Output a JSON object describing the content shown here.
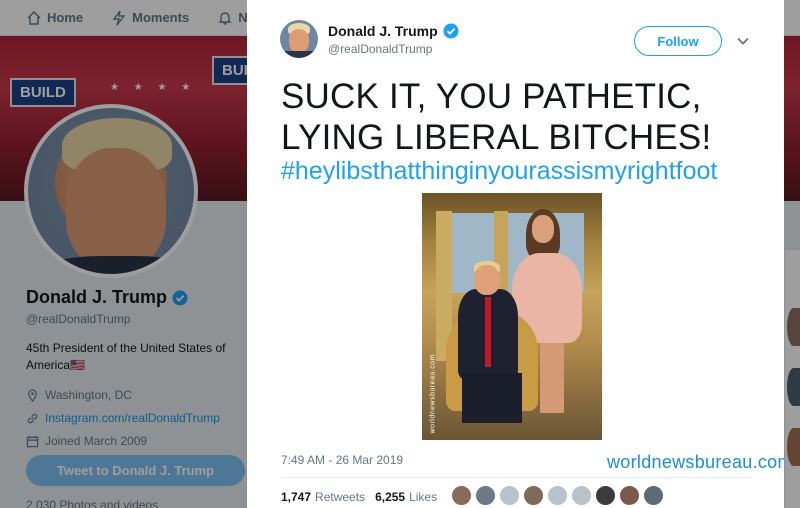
{
  "nav": {
    "home": "Home",
    "moments": "Moments",
    "notifications": "Notif"
  },
  "banner": {
    "sign_text": "BUILD"
  },
  "profile": {
    "name": "Donald J. Trump",
    "handle": "@realDonaldTrump",
    "bio": "45th President of the United States of America",
    "flag": "🇺🇸",
    "location": "Washington, DC",
    "website": "Instagram.com/realDonaldTrump",
    "joined": "Joined March 2009",
    "tweet_to_button": "Tweet to Donald J. Trump",
    "photos_label": "2,030 Photos and videos"
  },
  "tweet": {
    "author_name": "Donald J. Trump",
    "author_handle": "@realDonaldTrump",
    "follow_label": "Follow",
    "text": "SUCK IT, YOU PATHETIC, LYING LIBERAL BITCHES!",
    "hashtag": "#heylibsthatthinginyourassismyrightfoot",
    "image_watermark": "worldnewsbureau.com",
    "timestamp": "7:49 AM - 26 Mar 2019",
    "watermark": "worldnewsbureau.com",
    "retweets_count": "1,747",
    "retweets_label": "Retweets",
    "likes_count": "6,255",
    "likes_label": "Likes"
  },
  "colors": {
    "twitter_blue": "#1da1f2",
    "overlay": "rgba(0,0,0,0.38)",
    "verified": "#1da1f2"
  },
  "likers": [
    "#8a6b5a",
    "#6c7a86",
    "#b9c2cb",
    "#7c6b57",
    "#b9c2cb",
    "#b9c2cb",
    "#3b3b3b",
    "#7b5a4a",
    "#5d6b77"
  ]
}
